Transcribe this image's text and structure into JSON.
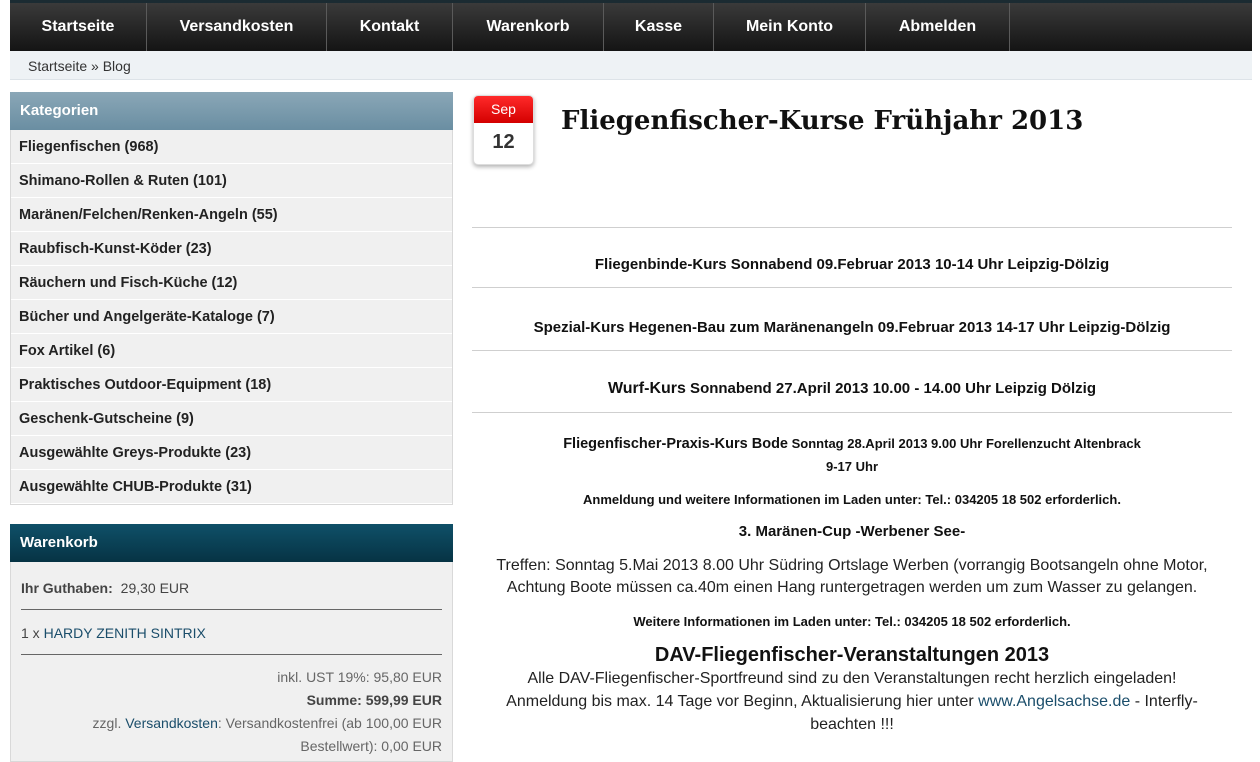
{
  "nav": {
    "items": [
      {
        "label": "Startseite"
      },
      {
        "label": "Versandkosten"
      },
      {
        "label": "Kontakt"
      },
      {
        "label": "Warenkorb"
      },
      {
        "label": "Kasse"
      },
      {
        "label": "Mein Konto"
      },
      {
        "label": "Abmelden"
      }
    ]
  },
  "breadcrumb": {
    "text": "Startseite » Blog"
  },
  "categories": {
    "title": "Kategorien",
    "items": [
      {
        "label": "Fliegenfischen (968)"
      },
      {
        "label": "Shimano-Rollen & Ruten (101)"
      },
      {
        "label": "Maränen/Felchen/Renken-Angeln (55)"
      },
      {
        "label": "Raubfisch-Kunst-Köder (23)"
      },
      {
        "label": "Räuchern und Fisch-Küche (12)"
      },
      {
        "label": "Bücher und Angelgeräte-Kataloge (7)"
      },
      {
        "label": "Fox Artikel (6)"
      },
      {
        "label": "Praktisches Outdoor-Equipment (18)"
      },
      {
        "label": "Geschenk-Gutscheine (9)"
      },
      {
        "label": "Ausgewählte Greys-Produkte (23)"
      },
      {
        "label": "Ausgewählte CHUB-Produkte (31)"
      }
    ]
  },
  "cart": {
    "title": "Warenkorb",
    "credit_label": "Ihr Guthaben:",
    "credit_value": "29,30 EUR",
    "item_qty": "1 x",
    "item_name": "HARDY ZENITH SINTRIX",
    "tax_line": "inkl. UST 19%: 95,80 EUR",
    "sum_line": "Summe: 599,99 EUR",
    "shipping_prefix": "zzgl.",
    "shipping_link": "Versandkosten",
    "shipping_rest": ": Versandkostenfrei (ab 100,00 EUR",
    "order_value": "Bestellwert): 0,00 EUR"
  },
  "post": {
    "month": "Sep",
    "day": "12",
    "title": "Fliegenfischer-Kurse Frühjahr 2013",
    "course1": "Fliegenbinde-Kurs  Sonnabend  09.Februar 2013  10-14 Uhr Leipzig-Dölzig",
    "course2": "Spezial-Kurs Hegenen-Bau zum Maränenangeln  09.Februar 2013  14-17 Uhr Leipzig-Dölzig",
    "course3_name": "Wurf-Kurs",
    "course3_rest": " Sonnabend 27.April 2013  10.00 - 14.00 Uhr  Leipzig Dölzig",
    "course4_name": "Fliegenfischer-Praxis-Kurs Bode",
    "course4_rest": " Sonntag 28.April 2013  9.00 Uhr Forellenzucht Altenbrack",
    "course4_time": "9-17 Uhr",
    "registration": "Anmeldung und weitere Informationen im Laden unter:  Tel.: 034205 18 502 erforderlich.",
    "cup_title": "3. Maränen-Cup -Werbener See-",
    "cup_line1": "Treffen: Sonntag 5.Mai 2013 8.00 Uhr Südring Ortslage Werben (vorrangig Bootsangeln ohne Motor,",
    "cup_line2": "Achtung Boote müssen ca.40m einen Hang runtergetragen werden um zum Wasser zu gelangen.",
    "info": "Weitere Informationen im Laden unter:  Tel.: 034205 18 502 erforderlich.",
    "dav_title": "DAV-Fliegenfischer-Veranstaltungen 2013",
    "dav_line1": "Alle DAV-Fliegenfischer-Sportfreund sind zu den Veranstaltungen recht herzlich eingeladen!",
    "dav_line2_pre": "Anmeldung bis max. 14 Tage vor Beginn, Aktualisierung hier unter ",
    "dav_link": "www.Angelsachse.de",
    "dav_line2_post": " - Interfly-",
    "dav_line3": "beachten !!!"
  }
}
